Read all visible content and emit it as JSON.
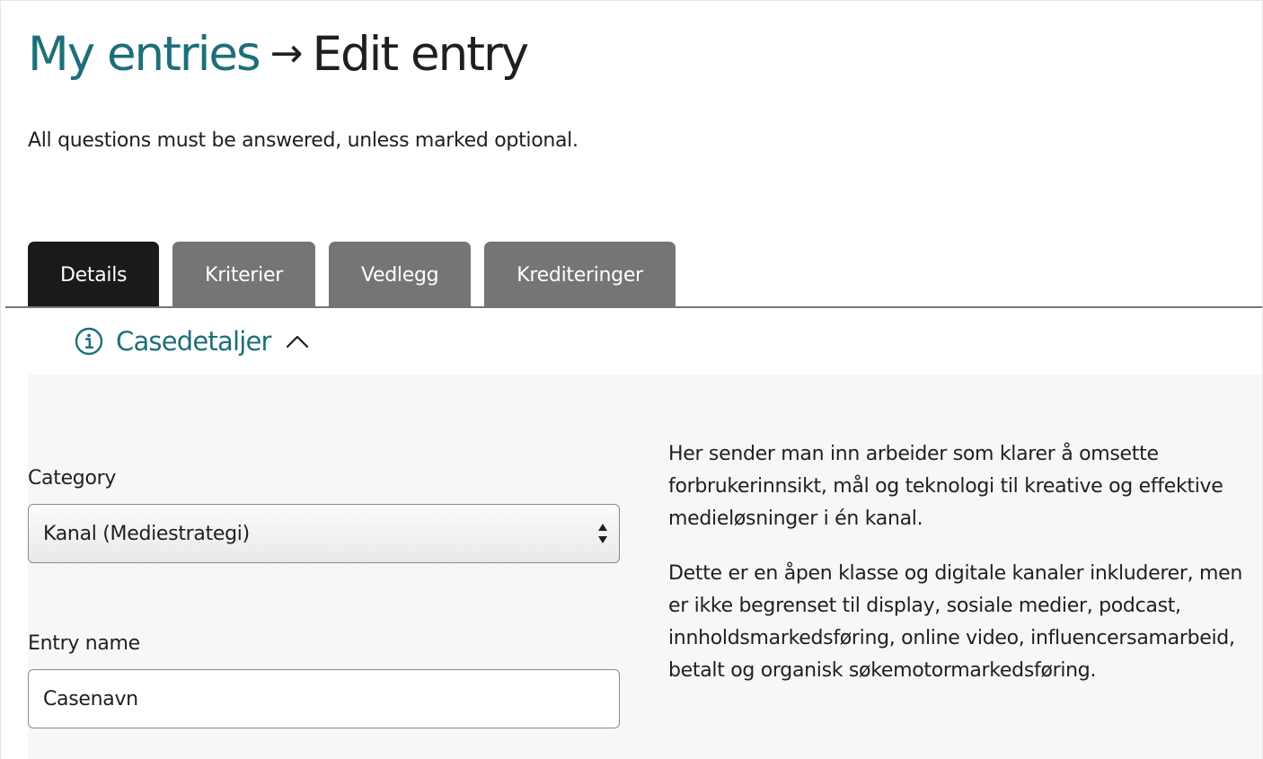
{
  "header": {
    "breadcrumb_link": "My entries",
    "arrow": "→",
    "current": "Edit entry"
  },
  "instructions": "All questions must be answered, unless marked optional.",
  "tabs": [
    {
      "label": "Details",
      "active": true
    },
    {
      "label": "Kriterier",
      "active": false
    },
    {
      "label": "Vedlegg",
      "active": false
    },
    {
      "label": "Krediteringer",
      "active": false
    }
  ],
  "section": {
    "title": "Casedetaljer",
    "icon": "info-circle-icon",
    "toggle_icon": "chevron-up-icon"
  },
  "form": {
    "category": {
      "label": "Category",
      "selected": "Kanal (Mediestrategi)"
    },
    "entry_name": {
      "label": "Entry name",
      "value": "Casenavn"
    }
  },
  "help_text": {
    "paragraph1": "Her sender man inn arbeider som klarer å omsette forbrukerinnsikt, mål og teknologi til kreative og effektive medieløsninger i én kanal.",
    "paragraph2": "Dette er en åpen klasse og digitale kanaler inkluderer, men er ikke begrenset til display, sosiale medier, podcast, innholdsmarkedsføring, online video, influencersamarbeid, betalt og organisk søkemotormarkedsføring."
  },
  "colors": {
    "link_teal": "#1d6f7a",
    "tab_active": "#1a1a1a",
    "tab_inactive": "#757575",
    "panel_bg": "#f7f7f7"
  }
}
